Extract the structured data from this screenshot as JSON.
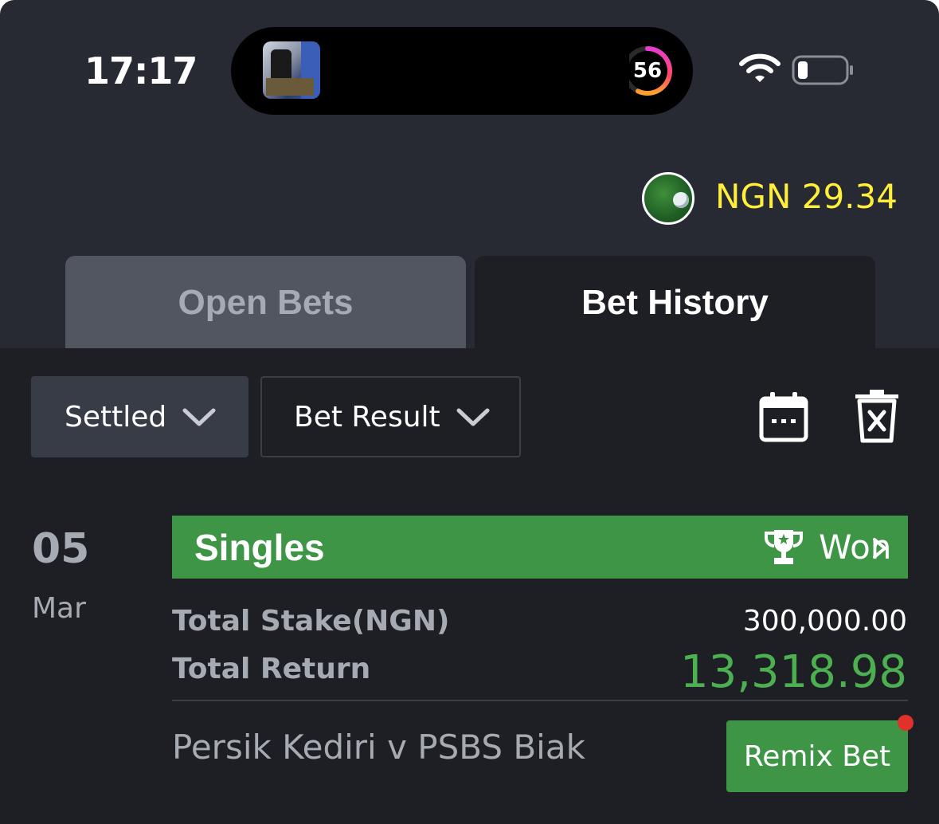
{
  "status_bar": {
    "time": "17:17",
    "activity_ring_value": "56",
    "icons": [
      "wifi-icon",
      "battery-icon"
    ]
  },
  "account": {
    "balance": "NGN 29.34",
    "avatar_icon": "football-avatar-icon"
  },
  "tabs": [
    {
      "label": "Open Bets",
      "active": false
    },
    {
      "label": "Bet History",
      "active": true
    }
  ],
  "filters": {
    "status": "Settled",
    "result": "Bet Result",
    "calendar_icon": "calendar-icon",
    "delete_icon": "delete-icon"
  },
  "bet": {
    "day": "05",
    "month": "Mar",
    "type": "Singles",
    "status": "Won",
    "status_icon": "trophy-icon",
    "stake_label": "Total Stake(NGN)",
    "stake_value": "300,000.00",
    "return_label": "Total Return",
    "return_value": "13,318.98",
    "match": "Persik Kediri v PSBS Biak",
    "remix_label": "Remix Bet"
  },
  "colors": {
    "background": "#272a33",
    "panel": "#1d1f24",
    "accent_green": "#3f9546",
    "return_green": "#4cb050",
    "balance_yellow": "#ffee3a",
    "notification_red": "#e0322a"
  }
}
